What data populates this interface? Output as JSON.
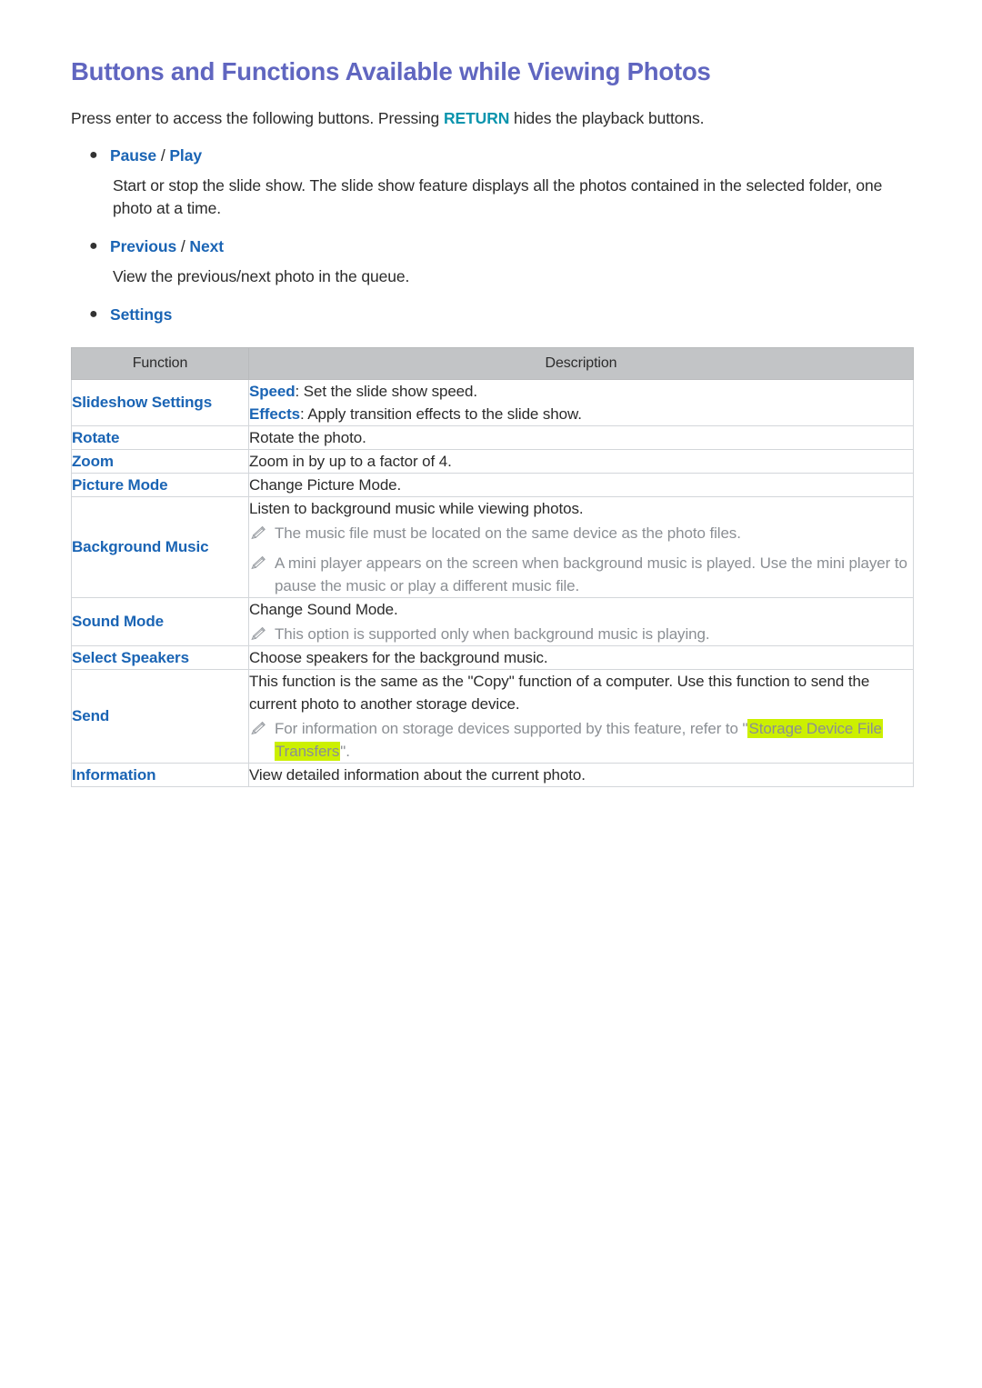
{
  "page": {
    "title": "Buttons and Functions Available while Viewing Photos",
    "intro_prefix": "Press enter to access the following buttons. Pressing ",
    "intro_keyword": "RETURN",
    "intro_suffix": " hides the playback buttons."
  },
  "bullets": [
    {
      "label_primary": "Pause",
      "separator": " / ",
      "label_secondary": "Play",
      "body": "Start or stop the slide show. The slide show feature displays all the photos contained in the selected folder, one photo at a time."
    },
    {
      "label_primary": "Previous",
      "separator": " / ",
      "label_secondary": "Next",
      "body": "View the previous/next photo in the queue."
    },
    {
      "label_primary": "Settings",
      "separator": "",
      "label_secondary": "",
      "body": ""
    }
  ],
  "table": {
    "headers": [
      "Function",
      "Description"
    ],
    "rows": [
      {
        "function": "Slideshow Settings",
        "lines": [
          {
            "type": "kv",
            "key": "Speed",
            "text": ": Set the slide show speed."
          },
          {
            "type": "kv",
            "key": "Effects",
            "text": ": Apply transition effects to the slide show."
          }
        ]
      },
      {
        "function": "Rotate",
        "lines": [
          {
            "type": "plain",
            "text": "Rotate the photo."
          }
        ]
      },
      {
        "function": "Zoom",
        "lines": [
          {
            "type": "plain",
            "text": "Zoom in by up to a factor of 4."
          }
        ]
      },
      {
        "function": "Picture Mode",
        "lines": [
          {
            "type": "plain",
            "text": "Change Picture Mode."
          }
        ]
      },
      {
        "function": "Background Music",
        "lines": [
          {
            "type": "plain",
            "text": "Listen to background music while viewing photos."
          },
          {
            "type": "note",
            "text": "The music file must be located on the same device as the photo files."
          },
          {
            "type": "note",
            "text": "A mini player appears on the screen when background music is played. Use the mini player to pause the music or play a different music file."
          }
        ]
      },
      {
        "function": "Sound Mode",
        "lines": [
          {
            "type": "plain",
            "text": "Change Sound Mode."
          },
          {
            "type": "note",
            "text": "This option is supported only when background music is playing."
          }
        ]
      },
      {
        "function": "Select Speakers",
        "lines": [
          {
            "type": "plain",
            "text": "Choose speakers for the background music."
          }
        ]
      },
      {
        "function": "Send",
        "lines": [
          {
            "type": "plain",
            "text": "This function is the same as the \"Copy\" function of a computer. Use this function to send the current photo to another storage device."
          },
          {
            "type": "note-link",
            "pre": "For information on storage devices supported by this feature, refer to \"",
            "link": "Storage Device File Transfers",
            "post": "\"."
          }
        ]
      },
      {
        "function": "Information",
        "lines": [
          {
            "type": "plain",
            "text": "View detailed information about the current photo."
          }
        ]
      }
    ]
  },
  "colors": {
    "title": "#6066c0",
    "link_blue": "#1a64b4",
    "keyword_teal": "#0a94ad",
    "note_gray": "#8b8f94",
    "highlight": "#ccf000",
    "table_header_bg": "#c2c4c6"
  },
  "icons": {
    "note": "pencil-icon",
    "bullet": "bullet-dot-icon"
  }
}
